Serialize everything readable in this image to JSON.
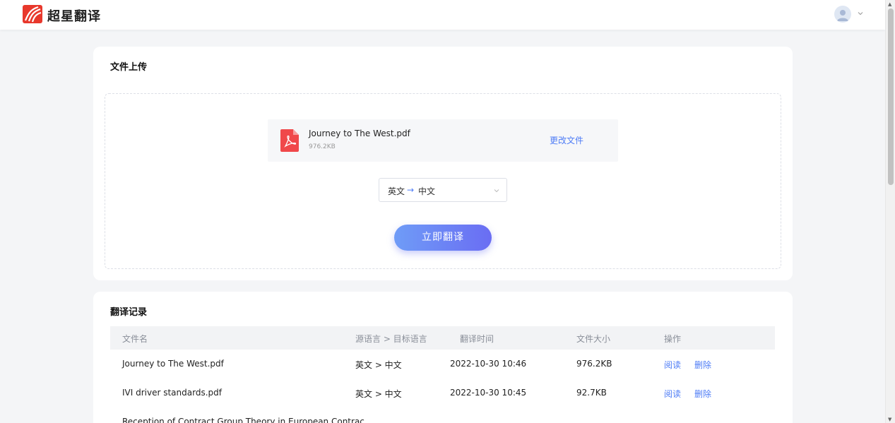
{
  "header": {
    "brand": "超星翻译",
    "brand_color": "#e8382c"
  },
  "upload": {
    "title": "文件上传",
    "file_name": "Journey to The West.pdf",
    "file_size": "976.2KB",
    "change_label": "更改文件",
    "lang_source": "英文",
    "lang_target": "中文",
    "lang_arrow": "→",
    "translate_label": "立即翻译"
  },
  "history": {
    "title": "翻译记录",
    "columns": [
      "文件名",
      "源语言 > 目标语言",
      "翻译时间",
      "文件大小",
      "操作"
    ],
    "rows": [
      {
        "name": "Journey to The West.pdf",
        "langs": "英文 > 中文",
        "time": "2022-10-30 10:46",
        "size": "976.2KB",
        "read": "阅读",
        "delete": "删除"
      },
      {
        "name": "IVI driver standards.pdf",
        "langs": "英文 > 中文",
        "time": "2022-10-30 10:45",
        "size": "92.7KB",
        "read": "阅读",
        "delete": "删除"
      },
      {
        "name": "Reception of Contract Group Theory in European Contrac...",
        "langs": "",
        "time": "",
        "size": "",
        "read": "",
        "delete": ""
      }
    ]
  },
  "colors": {
    "accent": "#4e7cf6",
    "button_gradient_start": "#6f9cf7",
    "button_gradient_end": "#6a6df3",
    "pdf_red": "#f0484a"
  }
}
